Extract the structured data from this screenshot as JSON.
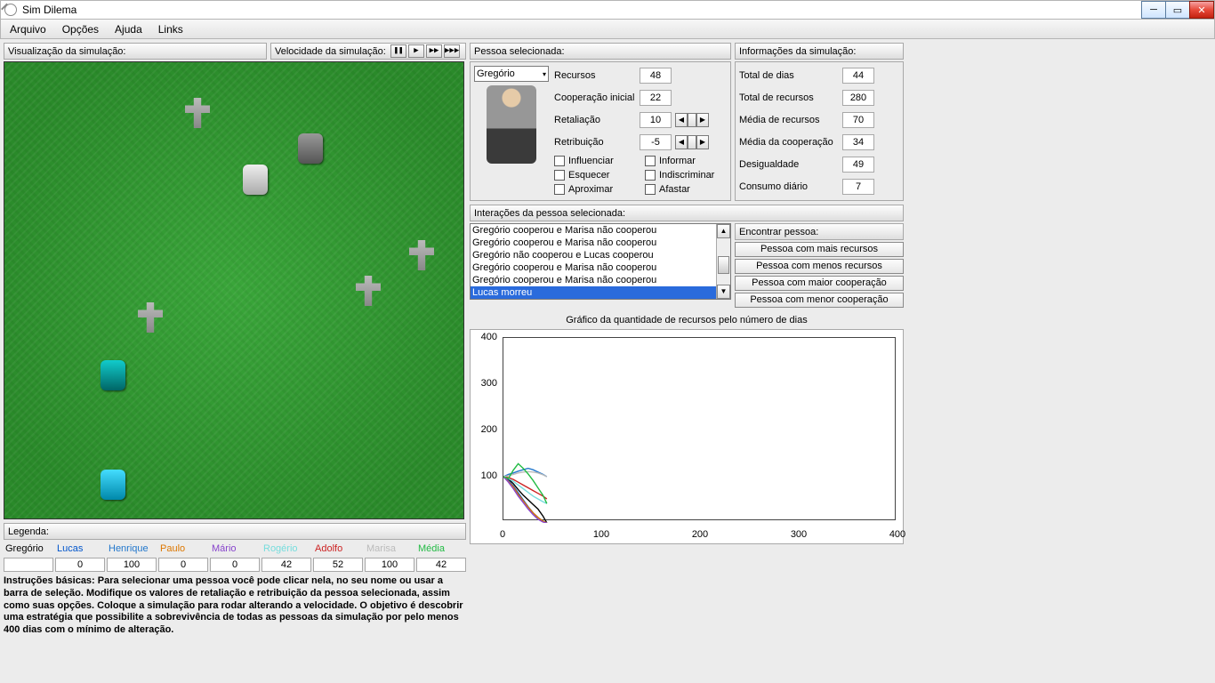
{
  "window": {
    "title": "Sim Dilema"
  },
  "menu": {
    "items": [
      "Arquivo",
      "Opções",
      "Ajuda",
      "Links"
    ]
  },
  "labels": {
    "sim_view": "Visualização da simulação:",
    "sim_speed": "Velocidade da simulação:",
    "selected_person": "Pessoa selecionada:",
    "sim_info": "Informações da simulação:",
    "interactions": "Interações da pessoa selecionada:",
    "find_person": "Encontrar pessoa:",
    "legend": "Legenda:",
    "chart_title": "Gráfico da quantidade de recursos pelo número de dias"
  },
  "speed_buttons": [
    "❚❚",
    "▶",
    "▶▶",
    "▶▶▶"
  ],
  "person": {
    "name": "Gregório",
    "fields": {
      "recursos_label": "Recursos",
      "recursos": "48",
      "coop_inicial_label": "Cooperação inicial",
      "coop_inicial": "22",
      "retaliacao_label": "Retaliação",
      "retaliacao": "10",
      "retribuicao_label": "Retribuição",
      "retribuicao": "-5"
    },
    "checks": {
      "influenciar": "Influenciar",
      "informar": "Informar",
      "esquecer": "Esquecer",
      "indiscriminar": "Indiscriminar",
      "aproximar": "Aproximar",
      "afastar": "Afastar"
    }
  },
  "simstats": {
    "total_dias_label": "Total de dias",
    "total_dias": "44",
    "total_recursos_label": "Total de recursos",
    "total_recursos": "280",
    "media_recursos_label": "Média de recursos",
    "media_recursos": "70",
    "media_coop_label": "Média da cooperação",
    "media_coop": "34",
    "desigualdade_label": "Desigualdade",
    "desigualdade": "49",
    "consumo_label": "Consumo diário",
    "consumo": "7"
  },
  "interactions": [
    "Gregório cooperou e Marisa não cooperou",
    "Gregório cooperou e Marisa não cooperou",
    "Gregório não cooperou e Lucas cooperou",
    "Gregório cooperou e Marisa não cooperou",
    "Gregório cooperou e Marisa não cooperou",
    "Lucas morreu"
  ],
  "interactions_selected_index": 5,
  "find_buttons": [
    "Pessoa com mais recursos",
    "Pessoa com menos recursos",
    "Pessoa com maior cooperação",
    "Pessoa com menor cooperação"
  ],
  "legend": {
    "names": [
      "Gregório",
      "Lucas",
      "Henrique",
      "Paulo",
      "Mário",
      "Rogério",
      "Adolfo",
      "Marisa",
      "Média"
    ],
    "colors": [
      "#000000",
      "#0055cc",
      "#2277cc",
      "#dd7700",
      "#8844cc",
      "#77dddd",
      "#cc2222",
      "#bbbbbb",
      "#22bb44"
    ],
    "values": [
      "",
      "0",
      "100",
      "0",
      "0",
      "42",
      "52",
      "100",
      "42"
    ]
  },
  "instructions": "Instruções básicas: Para selecionar uma pessoa você pode clicar nela, no seu nome ou usar a barra de seleção. Modifique os valores de retaliação e retribuição da pessoa selecionada, assim como suas opções. Coloque a simulação para rodar alterando a velocidade. O objetivo é descobrir uma estratégia que possibilite a sobrevivência de todas as pessoas da simulação por pelo menos 400 dias com o mínimo de alteração.",
  "chart_data": {
    "type": "line",
    "title": "Gráfico da quantidade de recursos pelo número de dias",
    "xlabel": "",
    "ylabel": "",
    "xlim": [
      0,
      400
    ],
    "ylim": [
      0,
      400
    ],
    "xticks": [
      0,
      100,
      200,
      300,
      400
    ],
    "yticks": [
      100,
      200,
      300,
      400
    ],
    "x": [
      0,
      5,
      10,
      15,
      20,
      25,
      30,
      35,
      40,
      44
    ],
    "series": [
      {
        "name": "Gregório",
        "color": "#000000",
        "values": [
          100,
          95,
          85,
          72,
          60,
          50,
          40,
          30,
          15,
          0
        ]
      },
      {
        "name": "Lucas",
        "color": "#0055cc",
        "values": [
          100,
          92,
          80,
          65,
          50,
          35,
          22,
          12,
          4,
          0
        ]
      },
      {
        "name": "Henrique",
        "color": "#2277cc",
        "values": [
          100,
          105,
          108,
          112,
          115,
          118,
          115,
          110,
          105,
          100
        ]
      },
      {
        "name": "Paulo",
        "color": "#dd7700",
        "values": [
          100,
          90,
          78,
          62,
          48,
          34,
          22,
          12,
          4,
          0
        ]
      },
      {
        "name": "Mário",
        "color": "#8844cc",
        "values": [
          100,
          88,
          74,
          58,
          44,
          30,
          18,
          8,
          2,
          0
        ]
      },
      {
        "name": "Rogério",
        "color": "#77dddd",
        "values": [
          100,
          96,
          90,
          82,
          74,
          66,
          58,
          52,
          46,
          42
        ]
      },
      {
        "name": "Adolfo",
        "color": "#cc2222",
        "values": [
          100,
          98,
          94,
          88,
          82,
          76,
          70,
          64,
          58,
          52
        ]
      },
      {
        "name": "Marisa",
        "color": "#bbbbbb",
        "values": [
          100,
          102,
          105,
          108,
          110,
          111,
          110,
          108,
          104,
          100
        ]
      },
      {
        "name": "Média",
        "color": "#22bb44",
        "values": [
          100,
          96,
          114,
          128,
          118,
          106,
          92,
          76,
          60,
          42
        ]
      }
    ]
  }
}
